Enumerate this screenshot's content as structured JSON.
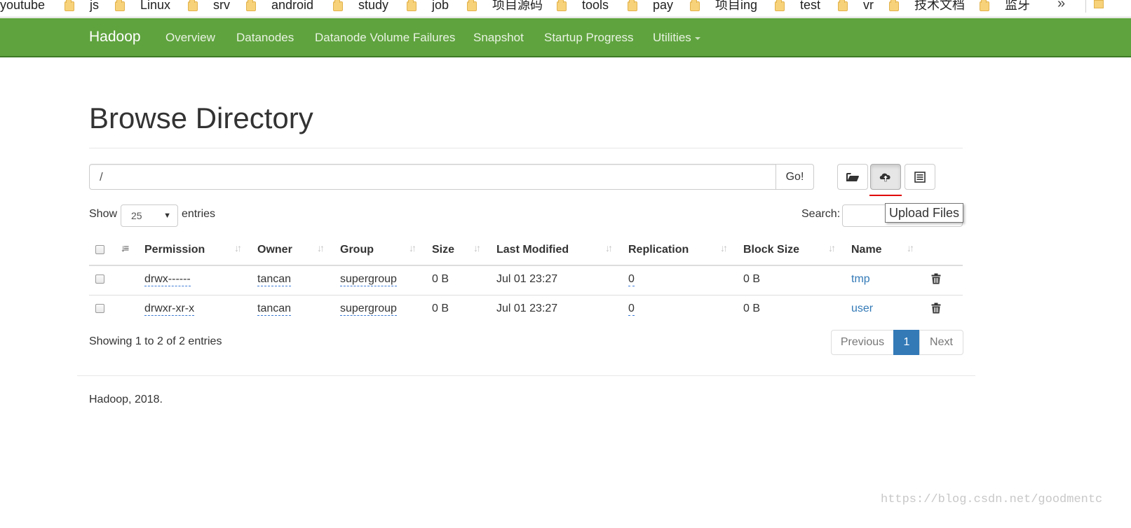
{
  "bookmarks": {
    "items": [
      "youtube",
      "js",
      "Linux",
      "srv",
      "android",
      "study",
      "job",
      "项目源码",
      "tools",
      "pay",
      "项目ing",
      "test",
      "vr",
      "技术文档",
      "监牙"
    ],
    "more": "»"
  },
  "navbar": {
    "brand": "Hadoop",
    "items": [
      "Overview",
      "Datanodes",
      "Datanode Volume Failures",
      "Snapshot",
      "Startup Progress",
      "Utilities"
    ],
    "color": "#5fa33e"
  },
  "page": {
    "title": "Browse Directory"
  },
  "path": {
    "value": "/",
    "go_label": "Go!"
  },
  "toolbar": {
    "create_dir_icon": "folder-open-icon",
    "upload_icon": "cloud-upload-icon",
    "cut_paste_icon": "list-alt-icon",
    "tooltip": "Upload Files"
  },
  "table_controls": {
    "show_label": "Show",
    "page_length": "25",
    "entries_label": "entries",
    "search_label": "Search:",
    "search_value": ""
  },
  "table": {
    "columns": [
      "Permission",
      "Owner",
      "Group",
      "Size",
      "Last Modified",
      "Replication",
      "Block Size",
      "Name"
    ],
    "rows": [
      {
        "permission": "drwx------",
        "owner": "tancan",
        "group": "supergroup",
        "size": "0 B",
        "last_modified": "Jul 01 23:27",
        "replication": "0",
        "block_size": "0 B",
        "name": "tmp"
      },
      {
        "permission": "drwxr-xr-x",
        "owner": "tancan",
        "group": "supergroup",
        "size": "0 B",
        "last_modified": "Jul 01 23:27",
        "replication": "0",
        "block_size": "0 B",
        "name": "user"
      }
    ]
  },
  "pagination": {
    "info": "Showing 1 to 2 of 2 entries",
    "previous": "Previous",
    "current": "1",
    "next": "Next"
  },
  "footer": {
    "text": "Hadoop, 2018."
  },
  "watermark": "https://blog.csdn.net/goodmentc"
}
